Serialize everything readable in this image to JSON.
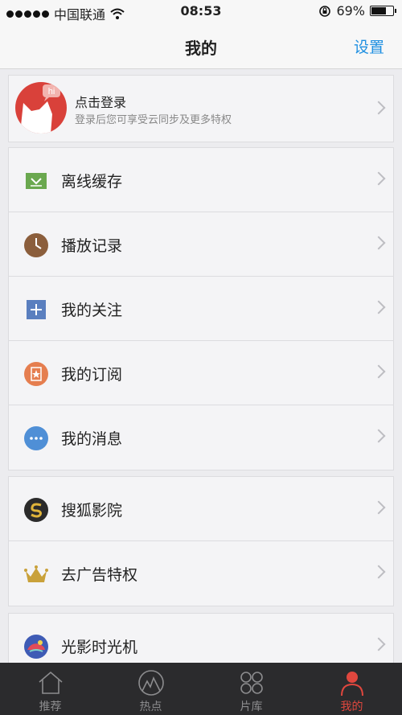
{
  "status_bar": {
    "carrier": "中国联通",
    "time": "08:53",
    "battery": "69%",
    "battery_level": 0.69
  },
  "nav": {
    "title": "我的",
    "settings": "设置"
  },
  "login": {
    "badge": "hi",
    "title": "点击登录",
    "subtitle": "登录后您可享受云同步及更多特权"
  },
  "group1": [
    {
      "label": "离线缓存",
      "icon": "download-icon",
      "color": "#6aa84f"
    },
    {
      "label": "播放记录",
      "icon": "clock-icon",
      "color": "#8b5e3c"
    },
    {
      "label": "我的关注",
      "icon": "plus-icon",
      "color": "#5a7fbf"
    },
    {
      "label": "我的订阅",
      "icon": "star-badge-icon",
      "color": "#e57e4f"
    },
    {
      "label": "我的消息",
      "icon": "message-dots-icon",
      "color": "#4f8fd6"
    }
  ],
  "group2": [
    {
      "label": "搜狐影院",
      "icon": "sohu-cinema-icon",
      "color": "#2b2b2b"
    },
    {
      "label": "去广告特权",
      "icon": "crown-icon",
      "color": "#c9a13a"
    }
  ],
  "group3": [
    {
      "label": "光影时光机",
      "icon": "time-machine-icon",
      "color": "#3e5bb5"
    }
  ],
  "tabs": [
    {
      "label": "推荐",
      "icon": "home-icon",
      "active": false
    },
    {
      "label": "热点",
      "icon": "flame-icon",
      "active": false
    },
    {
      "label": "片库",
      "icon": "grid-circles-icon",
      "active": false
    },
    {
      "label": "我的",
      "icon": "person-icon",
      "active": true
    }
  ],
  "colors": {
    "accent": "#1e8fe1",
    "active_tab": "#e0473e",
    "tabbar_bg": "#2b2b2d"
  }
}
